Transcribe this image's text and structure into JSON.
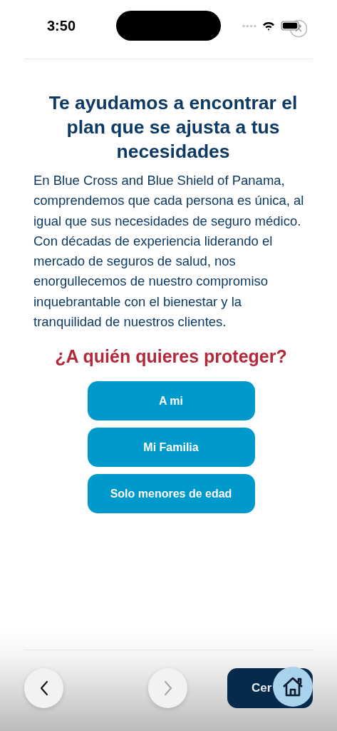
{
  "status_bar": {
    "time": "3:50"
  },
  "title": "Te ayudamos a encontrar el plan que se ajusta a tus necesidades",
  "description": "En Blue Cross and Blue Shield of Panama, comprendemos que cada persona es única, al igual que sus necesidades de seguro médico. Con décadas de experiencia liderando el mercado de seguros de salud, nos enorgullecemos de nuestro compromiso inquebrantable con el bienestar y la tranquilidad de nuestros clientes.",
  "question": "¿A quién quieres proteger?",
  "options": [
    {
      "label": "A mi"
    },
    {
      "label": "Mi Familia"
    },
    {
      "label": "Solo menores de edad"
    }
  ],
  "footer": {
    "back_button": {
      "disabled": false
    },
    "next_button": {
      "disabled": true
    },
    "close_button": {
      "label": "Cer"
    }
  }
}
